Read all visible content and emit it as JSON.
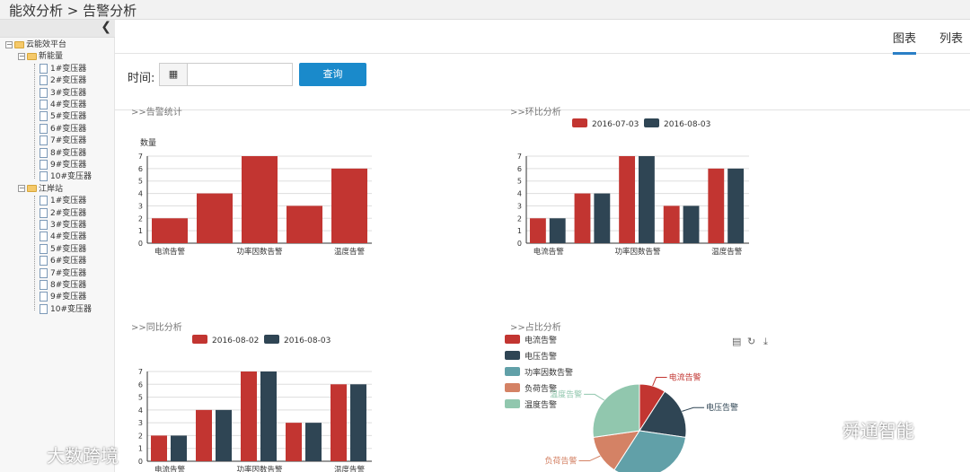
{
  "breadcrumb": "能效分析 > 告警分析",
  "sidebar": {
    "collapse_icon": "chevron-left-icon",
    "root": {
      "label": "云能效平台"
    },
    "groups": [
      {
        "label": "新能量",
        "items": [
          "1#变压器",
          "2#变压器",
          "3#变压器",
          "4#变压器",
          "5#变压器",
          "6#变压器",
          "7#变压器",
          "8#变压器",
          "9#变压器",
          "10#变压器"
        ]
      },
      {
        "label": "江岸站",
        "items": [
          "1#变压器",
          "2#变压器",
          "3#变压器",
          "4#变压器",
          "5#变压器",
          "6#变压器",
          "7#变压器",
          "8#变压器",
          "9#变压器",
          "10#变压器"
        ]
      }
    ]
  },
  "tabs": [
    {
      "label": "图表",
      "active": true
    },
    {
      "label": "列表",
      "active": false
    }
  ],
  "filter": {
    "label": "时间:",
    "date_value": "",
    "query_button": "查询"
  },
  "sections": {
    "alarm_stats": ">>告警统计",
    "mom": ">>环比分析",
    "yoy": ">>同比分析",
    "share": ">>占比分析"
  },
  "colors": {
    "red": "#c23531",
    "navy": "#2f4554",
    "teal": "#61a0a8",
    "orange": "#d48265",
    "green": "#91c7ae",
    "primary": "#1a8acb"
  },
  "toolbox": [
    "document-icon",
    "refresh-icon",
    "download-icon"
  ],
  "watermarks": {
    "left": "大数跨境",
    "right": "舜通智能"
  },
  "chart_data": [
    {
      "type": "bar",
      "title": ">>告警统计",
      "ylabel": "数量",
      "categories": [
        "电流告警",
        "电压告警",
        "功率因数告警",
        "负荷告警",
        "温度告警"
      ],
      "tick_labels_shown": [
        "电流告警",
        "功率因数告警",
        "温度告警"
      ],
      "values": [
        2,
        4,
        7,
        3,
        6
      ],
      "ylim": [
        0,
        7
      ],
      "grid": true
    },
    {
      "type": "bar",
      "title": ">>环比分析",
      "categories": [
        "电流告警",
        "电压告警",
        "功率因数告警",
        "负荷告警",
        "温度告警"
      ],
      "tick_labels_shown": [
        "电流告警",
        "功率因数告警",
        "温度告警"
      ],
      "series": [
        {
          "name": "2016-07-03",
          "values": [
            2,
            4,
            7,
            3,
            6
          ]
        },
        {
          "name": "2016-08-03",
          "values": [
            2,
            4,
            7,
            3,
            6
          ]
        }
      ],
      "ylim": [
        0,
        7
      ],
      "legend": "top-center",
      "grid": true
    },
    {
      "type": "bar",
      "title": ">>同比分析",
      "categories": [
        "电流告警",
        "电压告警",
        "功率因数告警",
        "负荷告警",
        "温度告警"
      ],
      "tick_labels_shown": [
        "电流告警",
        "功率因数告警",
        "温度告警"
      ],
      "series": [
        {
          "name": "2016-08-02",
          "values": [
            2,
            4,
            7,
            3,
            6
          ]
        },
        {
          "name": "2016-08-03",
          "values": [
            2,
            4,
            7,
            3,
            6
          ]
        }
      ],
      "ylim": [
        0,
        7
      ],
      "legend": "top-center",
      "grid": true
    },
    {
      "type": "pie",
      "title": ">>占比分析",
      "labels": [
        "电流告警",
        "电压告警",
        "功率因数告警",
        "负荷告警",
        "温度告警"
      ],
      "values": [
        2,
        4,
        7,
        3,
        6
      ],
      "visible_slice_labels": [
        "电流告警",
        "电压告警",
        "负荷告警",
        "温度告警"
      ],
      "legend": "top-left"
    }
  ]
}
